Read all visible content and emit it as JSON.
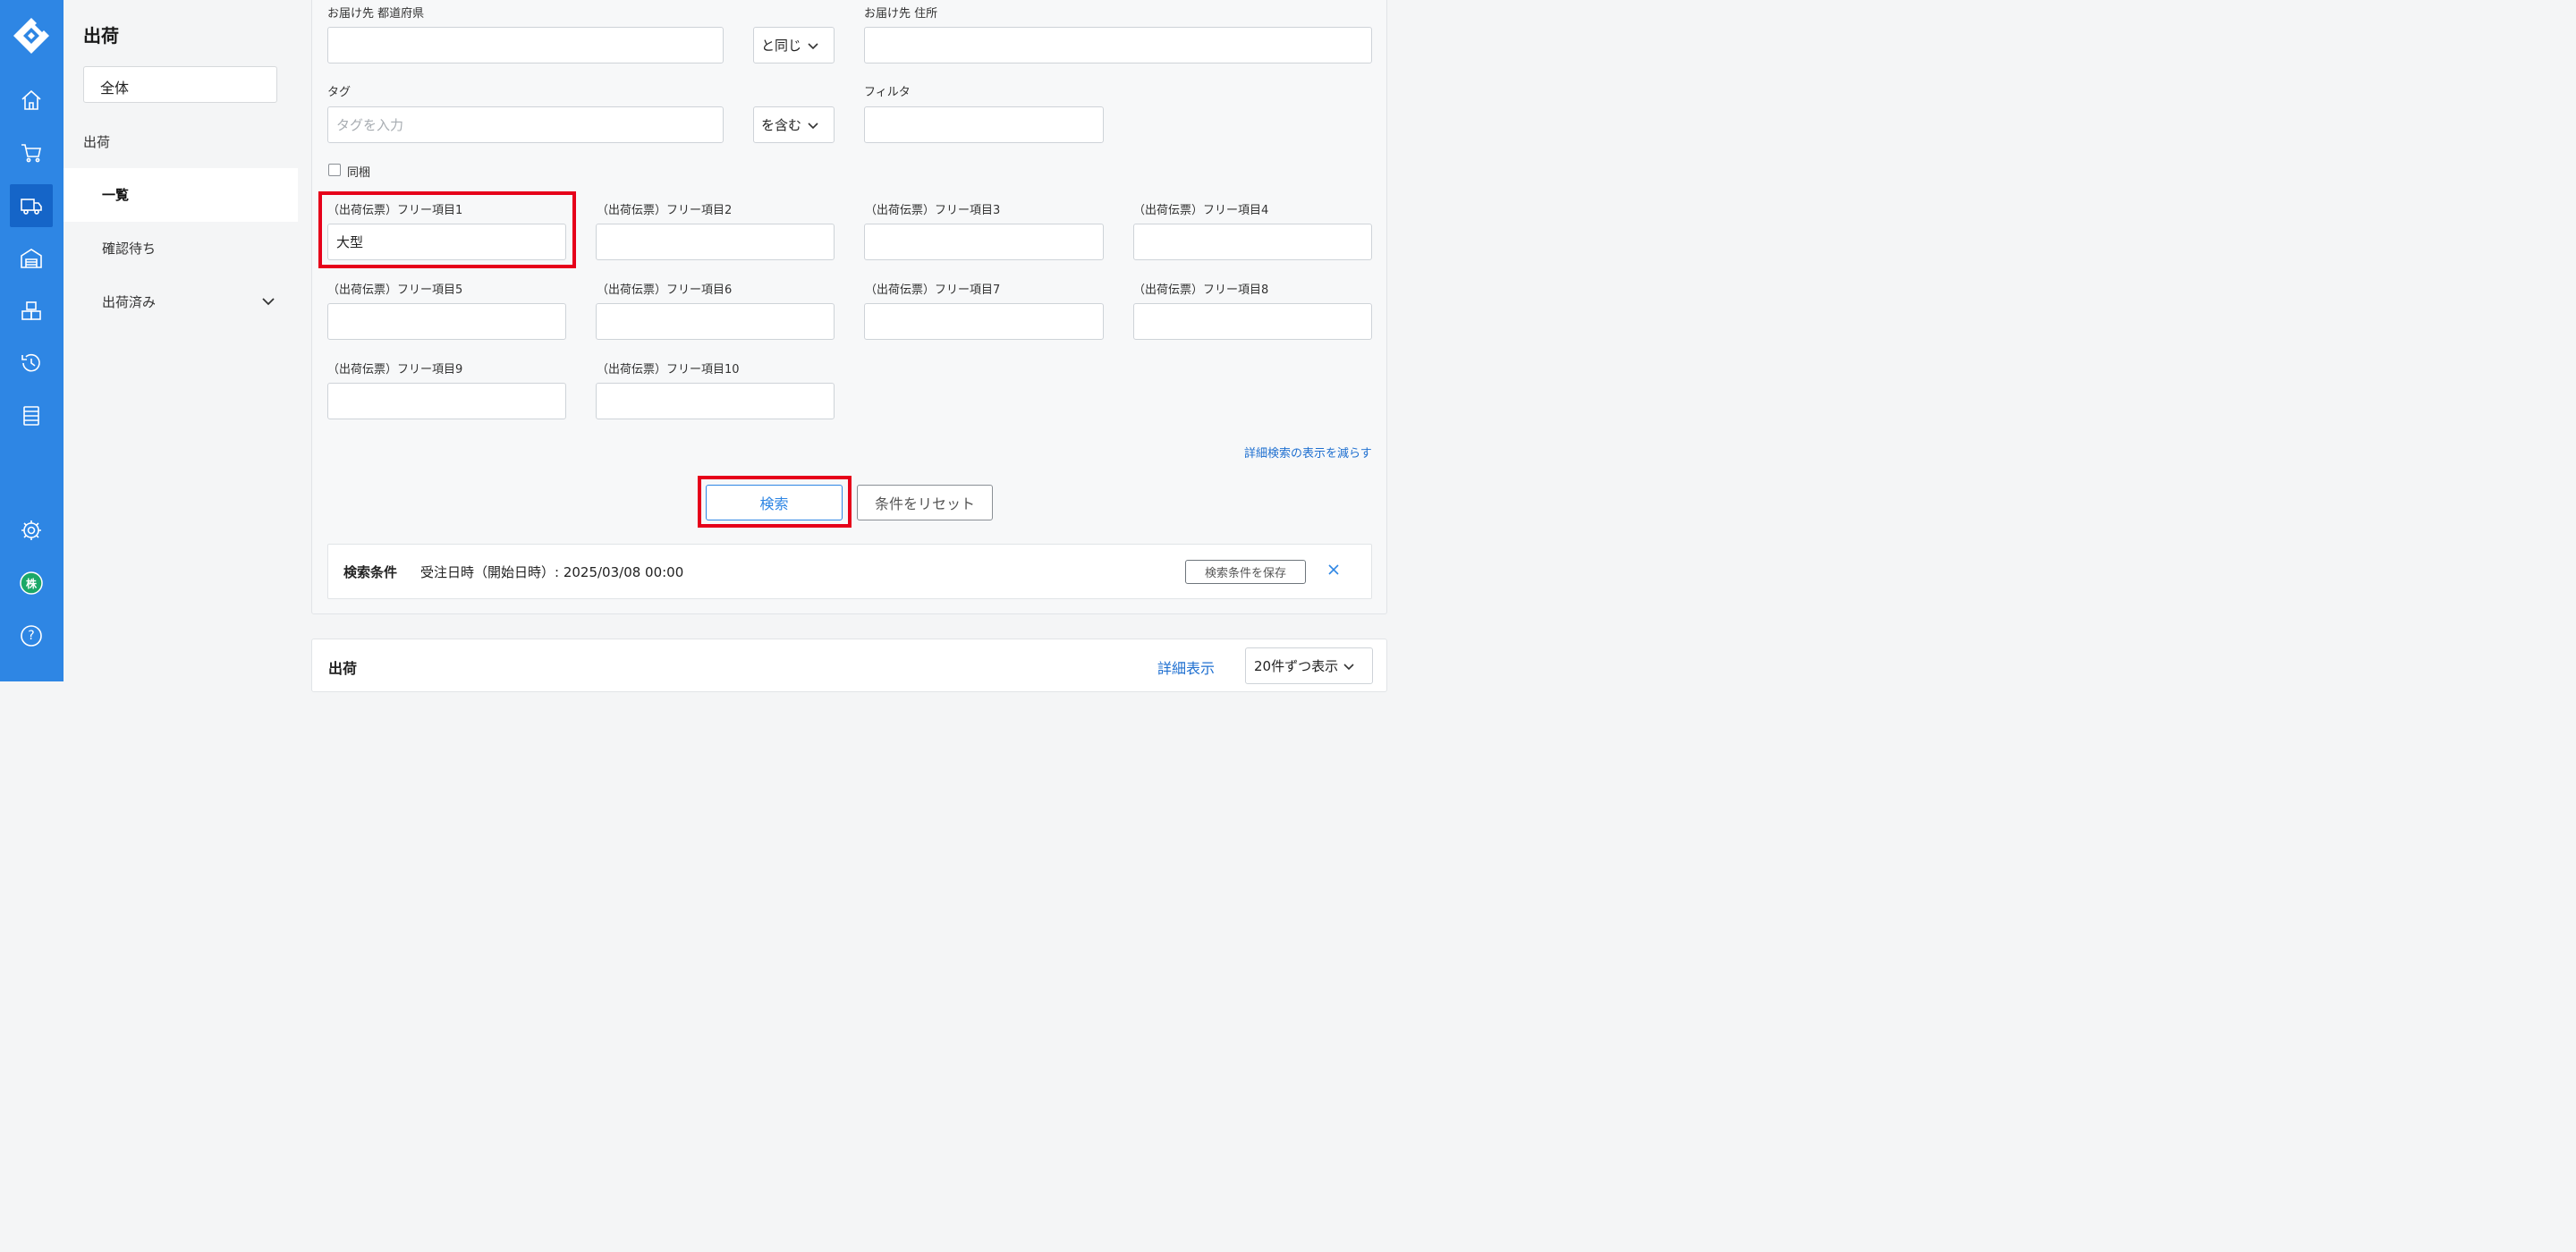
{
  "rail": {
    "icons": [
      "logo-icon",
      "home-icon",
      "cart-icon",
      "truck-icon",
      "warehouse-icon",
      "boxes-icon",
      "history-icon",
      "list-icon",
      "gear-icon",
      "avatar",
      "help-icon"
    ],
    "avatar_label": "株",
    "help_label": "?",
    "active": "truck-icon"
  },
  "sidebar": {
    "title": "出荷",
    "scope": "全体",
    "section": "出荷",
    "items": [
      {
        "label": "一覧",
        "active": true
      },
      {
        "label": "確認待ち",
        "active": false
      },
      {
        "label": "出荷済み",
        "active": false,
        "expandable": true
      }
    ]
  },
  "search": {
    "prefecture_label": "お届け先 都道府県",
    "prefecture_value": "",
    "prefecture_op": "と同じ",
    "address_label": "お届け先 住所",
    "address_value": "",
    "tag_label": "タグ",
    "tag_placeholder": "タグを入力",
    "tag_op": "を含む",
    "filter_label": "フィルタ",
    "filter_value": "",
    "bundle_label": "同梱",
    "bundle_checked": false,
    "free_fields": [
      {
        "label": "（出荷伝票）フリー項目1",
        "value": "大型"
      },
      {
        "label": "（出荷伝票）フリー項目2",
        "value": ""
      },
      {
        "label": "（出荷伝票）フリー項目3",
        "value": ""
      },
      {
        "label": "（出荷伝票）フリー項目4",
        "value": ""
      },
      {
        "label": "（出荷伝票）フリー項目5",
        "value": ""
      },
      {
        "label": "（出荷伝票）フリー項目6",
        "value": ""
      },
      {
        "label": "（出荷伝票）フリー項目7",
        "value": ""
      },
      {
        "label": "（出荷伝票）フリー項目8",
        "value": ""
      },
      {
        "label": "（出荷伝票）フリー項目9",
        "value": ""
      },
      {
        "label": "（出荷伝票）フリー項目10",
        "value": ""
      }
    ],
    "less_link": "詳細検索の表示を減らす",
    "search_button": "検索",
    "reset_button": "条件をリセット"
  },
  "conditions": {
    "heading": "検索条件",
    "value": "受注日時（開始日時）: 2025/03/08 00:00",
    "save_button": "検索条件を保存"
  },
  "list": {
    "title": "出荷",
    "detail_link": "詳細表示",
    "per_page": "20件ずつ表示"
  },
  "colors": {
    "rail": "#2e86e4",
    "rail_active": "#1565c8",
    "highlight": "#e6001a",
    "link": "#1e6fd0",
    "avatar": "#1ba868"
  }
}
